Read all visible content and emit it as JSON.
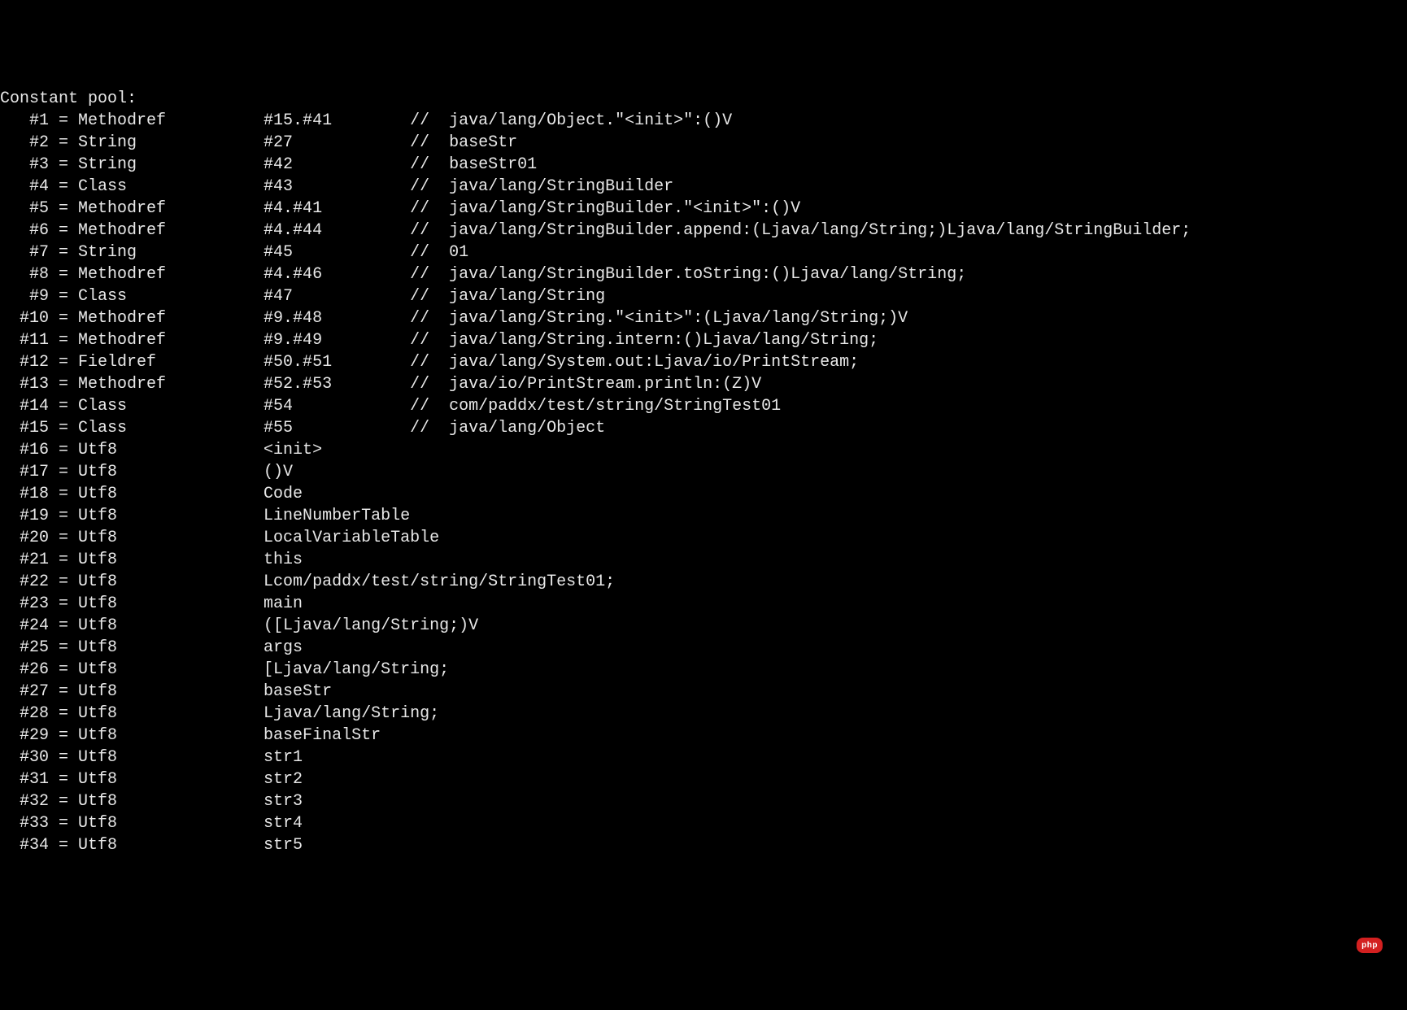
{
  "header": "Constant pool:",
  "entries": [
    {
      "idx": "   #1 = Methodref          #15.#41        //  java/lang/Object.\"<init>\":()V"
    },
    {
      "idx": "   #2 = String             #27            //  baseStr"
    },
    {
      "idx": "   #3 = String             #42            //  baseStr01"
    },
    {
      "idx": "   #4 = Class              #43            //  java/lang/StringBuilder"
    },
    {
      "idx": "   #5 = Methodref          #4.#41         //  java/lang/StringBuilder.\"<init>\":()V"
    },
    {
      "idx": "   #6 = Methodref          #4.#44         //  java/lang/StringBuilder.append:(Ljava/lang/String;)Ljava/lang/StringBuilder;"
    },
    {
      "idx": "   #7 = String             #45            //  01"
    },
    {
      "idx": "   #8 = Methodref          #4.#46         //  java/lang/StringBuilder.toString:()Ljava/lang/String;"
    },
    {
      "idx": "   #9 = Class              #47            //  java/lang/String"
    },
    {
      "idx": "  #10 = Methodref          #9.#48         //  java/lang/String.\"<init>\":(Ljava/lang/String;)V"
    },
    {
      "idx": "  #11 = Methodref          #9.#49         //  java/lang/String.intern:()Ljava/lang/String;"
    },
    {
      "idx": "  #12 = Fieldref           #50.#51        //  java/lang/System.out:Ljava/io/PrintStream;"
    },
    {
      "idx": "  #13 = Methodref          #52.#53        //  java/io/PrintStream.println:(Z)V"
    },
    {
      "idx": "  #14 = Class              #54            //  com/paddx/test/string/StringTest01"
    },
    {
      "idx": "  #15 = Class              #55            //  java/lang/Object"
    },
    {
      "idx": "  #16 = Utf8               <init>"
    },
    {
      "idx": "  #17 = Utf8               ()V"
    },
    {
      "idx": "  #18 = Utf8               Code"
    },
    {
      "idx": "  #19 = Utf8               LineNumberTable"
    },
    {
      "idx": "  #20 = Utf8               LocalVariableTable"
    },
    {
      "idx": "  #21 = Utf8               this"
    },
    {
      "idx": "  #22 = Utf8               Lcom/paddx/test/string/StringTest01;"
    },
    {
      "idx": "  #23 = Utf8               main"
    },
    {
      "idx": "  #24 = Utf8               ([Ljava/lang/String;)V"
    },
    {
      "idx": "  #25 = Utf8               args"
    },
    {
      "idx": "  #26 = Utf8               [Ljava/lang/String;"
    },
    {
      "idx": "  #27 = Utf8               baseStr"
    },
    {
      "idx": "  #28 = Utf8               Ljava/lang/String;"
    },
    {
      "idx": "  #29 = Utf8               baseFinalStr"
    },
    {
      "idx": "  #30 = Utf8               str1"
    },
    {
      "idx": "  #31 = Utf8               str2"
    },
    {
      "idx": "  #32 = Utf8               str3"
    },
    {
      "idx": "  #33 = Utf8               str4"
    },
    {
      "idx": "  #34 = Utf8               str5"
    }
  ],
  "watermark": "php"
}
